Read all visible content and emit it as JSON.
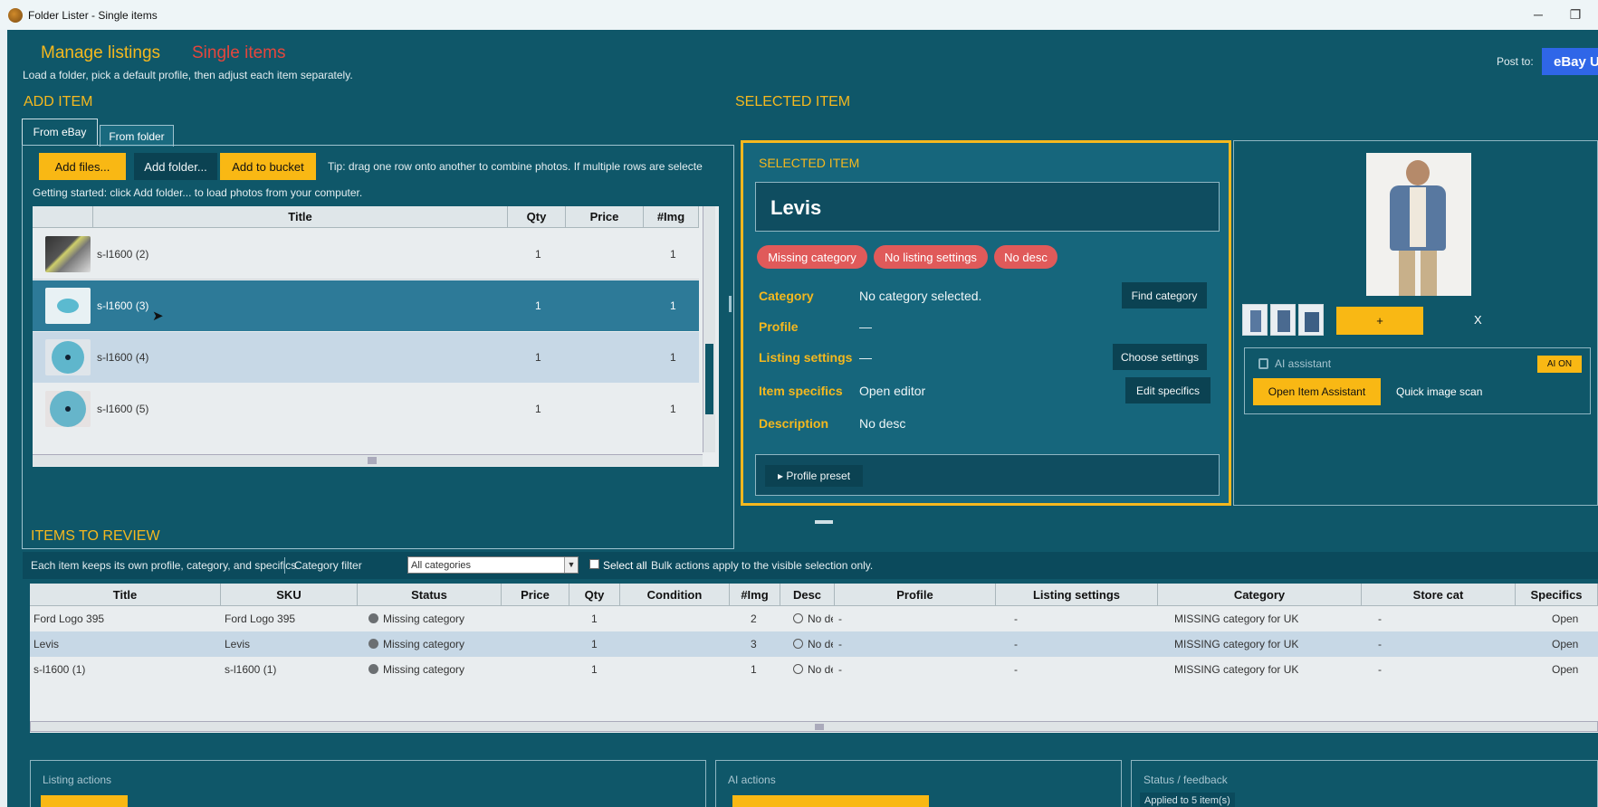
{
  "window": {
    "title": "Folder Lister - Single items"
  },
  "header": {
    "tab_manage": "Manage listings",
    "tab_single": "Single items",
    "subtitle": "Load a folder, pick a default profile, then adjust each item separately.",
    "post_to_label": "Post to:",
    "post_to_value": "eBay U"
  },
  "add_item": {
    "title": "ADD ITEM",
    "tabs": [
      "From eBay",
      "From folder"
    ],
    "buttons": {
      "add_files": "Add files...",
      "add_folder": "Add folder...",
      "add_bucket": "Add to bucket"
    },
    "tip": "Tip: drag one row onto another to combine photos. If multiple rows are selecte",
    "getting_started": "Getting started: click Add folder... to load photos from your computer.",
    "columns": [
      "",
      "Title",
      "Qty",
      "Price",
      "#Img"
    ],
    "rows": [
      {
        "title": "s-l1600 (2)",
        "qty": "1",
        "price": "",
        "img": "1"
      },
      {
        "title": "s-l1600 (3)",
        "qty": "1",
        "price": "",
        "img": "1"
      },
      {
        "title": "s-l1600 (4)",
        "qty": "1",
        "price": "",
        "img": "1"
      },
      {
        "title": "s-l1600 (5)",
        "qty": "1",
        "price": "",
        "img": "1"
      }
    ]
  },
  "selected": {
    "section_title": "SELECTED ITEM",
    "card_title": "SELECTED ITEM",
    "name": "Levis",
    "pills": [
      "Missing category",
      "No listing settings",
      "No desc"
    ],
    "fields": {
      "category_label": "Category",
      "category_value": "No category selected.",
      "category_btn": "Find category",
      "profile_label": "Profile",
      "profile_value": "—",
      "listing_label": "Listing settings",
      "listing_value": "—",
      "listing_btn": "Choose settings",
      "specifics_label": "Item specifics",
      "specifics_value": "Open editor",
      "specifics_btn": "Edit specifics",
      "desc_label": "Description",
      "desc_value": "No desc"
    },
    "profile_preset": "▸ Profile preset",
    "add_image": "+",
    "remove_image": "X",
    "ai": {
      "label": "AI assistant",
      "badge": "AI ON",
      "open_btn": "Open Item Assistant",
      "scan_btn": "Quick image scan"
    }
  },
  "review": {
    "title": "ITEMS TO REVIEW",
    "note": "Each item keeps its own profile, category, and specifics.",
    "filter_label": "Category filter",
    "filter_value": "All categories",
    "select_all": "Select all",
    "bulk_note": "Bulk actions apply to the visible selection only.",
    "columns": [
      "Title",
      "SKU",
      "Status",
      "Price",
      "Qty",
      "Condition",
      "#Img",
      "Desc",
      "Profile",
      "Listing settings",
      "Category",
      "Store cat",
      "Specifics"
    ],
    "rows": [
      {
        "title": "Ford Logo 395",
        "sku": "Ford Logo 395",
        "status": "Missing category",
        "price": "",
        "qty": "1",
        "condition": "",
        "img": "2",
        "desc": "No des",
        "profile": "-",
        "listing": "-",
        "category": "MISSING category for UK",
        "store": "-",
        "specifics": "Open"
      },
      {
        "title": "Levis",
        "sku": "Levis",
        "status": "Missing category",
        "price": "",
        "qty": "1",
        "condition": "",
        "img": "3",
        "desc": "No des",
        "profile": "-",
        "listing": "-",
        "category": "MISSING category for UK",
        "store": "-",
        "specifics": "Open"
      },
      {
        "title": "s-l1600 (1)",
        "sku": "s-l1600 (1)",
        "status": "Missing category",
        "price": "",
        "qty": "1",
        "condition": "",
        "img": "1",
        "desc": "No des",
        "profile": "-",
        "listing": "-",
        "category": "MISSING category for UK",
        "store": "-",
        "specifics": "Open"
      }
    ]
  },
  "bottom": {
    "listing_actions": "Listing actions",
    "ai_actions": "AI actions",
    "status_feedback": "Status / feedback",
    "applied_text": "Applied to 5 item(s)"
  },
  "colors": {
    "accent": "#f9b814",
    "background": "#0f5769",
    "alert": "#e05a5a",
    "ebay_button": "#2f66e8"
  }
}
